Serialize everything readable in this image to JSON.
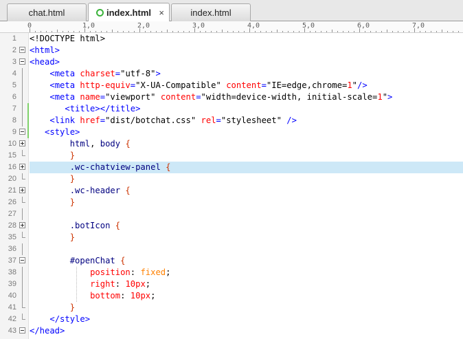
{
  "tabs": [
    {
      "label": "chat.html",
      "active": false,
      "has_close": false,
      "modified_indicator": false
    },
    {
      "label": "index.html",
      "active": true,
      "has_close": true,
      "modified_indicator": true
    },
    {
      "label": "index.html",
      "active": false,
      "has_close": false,
      "modified_indicator": false
    }
  ],
  "close_glyph": "×",
  "ruler": {
    "labels": [
      "0",
      "1,0",
      "2,0",
      "3,0",
      "4,0",
      "5,0",
      "6,0",
      "7,0"
    ]
  },
  "colors": {
    "tag": "#0000ff",
    "attribute": "#ff0000",
    "selector": "#000080",
    "brace": "#cc3300",
    "highlight": "#cde8f7",
    "change_bar": "#7fd26a"
  },
  "lines": [
    {
      "num": "1",
      "fold": null,
      "tokens": [
        [
          "plain",
          "<!DOCTYPE html>"
        ]
      ]
    },
    {
      "num": "2",
      "fold": "minus",
      "tokens": [
        [
          "tag",
          "<html>"
        ]
      ]
    },
    {
      "num": "3",
      "fold": "minus",
      "tokens": [
        [
          "tag",
          "<head>"
        ]
      ]
    },
    {
      "num": "4",
      "fold": null,
      "tokens": [
        [
          "plain",
          "    "
        ],
        [
          "tag",
          "<meta "
        ],
        [
          "attr",
          "charset"
        ],
        [
          "tag",
          "="
        ],
        [
          "val",
          "\"utf-8\""
        ],
        [
          "tag",
          ">"
        ]
      ]
    },
    {
      "num": "5",
      "fold": null,
      "tokens": [
        [
          "plain",
          "    "
        ],
        [
          "tag",
          "<meta "
        ],
        [
          "attr",
          "http-equiv"
        ],
        [
          "tag",
          "="
        ],
        [
          "val",
          "\"X-UA-Compatible\" "
        ],
        [
          "attr",
          "content"
        ],
        [
          "tag",
          "="
        ],
        [
          "val",
          "\"IE=edge,chrome="
        ],
        [
          "num",
          "1"
        ],
        [
          "val",
          "\""
        ],
        [
          "tag",
          "/>"
        ]
      ]
    },
    {
      "num": "6",
      "fold": null,
      "tokens": [
        [
          "plain",
          "    "
        ],
        [
          "tag",
          "<meta "
        ],
        [
          "attr",
          "name"
        ],
        [
          "tag",
          "="
        ],
        [
          "val",
          "\"viewport\" "
        ],
        [
          "attr",
          "content"
        ],
        [
          "tag",
          "="
        ],
        [
          "val",
          "\"width=device-width, initial-scale="
        ],
        [
          "num",
          "1"
        ],
        [
          "val",
          "\""
        ],
        [
          "tag",
          ">"
        ]
      ]
    },
    {
      "num": "7",
      "fold": null,
      "tokens": [
        [
          "plain",
          "       "
        ],
        [
          "tag",
          "<title></title>"
        ]
      ]
    },
    {
      "num": "8",
      "fold": null,
      "tokens": [
        [
          "plain",
          "    "
        ],
        [
          "tag",
          "<link "
        ],
        [
          "attr",
          "href"
        ],
        [
          "tag",
          "="
        ],
        [
          "val",
          "\"dist/botchat.css\" "
        ],
        [
          "attr",
          "rel"
        ],
        [
          "tag",
          "="
        ],
        [
          "val",
          "\"stylesheet\" "
        ],
        [
          "tag",
          "/>"
        ]
      ]
    },
    {
      "num": "9",
      "fold": "minus",
      "tokens": [
        [
          "plain",
          "   "
        ],
        [
          "tag",
          "<style>"
        ]
      ]
    },
    {
      "num": "10",
      "fold": "plus",
      "tokens": [
        [
          "plain",
          "        "
        ],
        [
          "sel",
          "html"
        ],
        [
          "plain",
          ", "
        ],
        [
          "sel",
          "body"
        ],
        [
          "plain",
          " "
        ],
        [
          "brace",
          "{"
        ]
      ]
    },
    {
      "num": "15",
      "fold": null,
      "tokens": [
        [
          "plain",
          "        "
        ],
        [
          "brace",
          "}"
        ]
      ]
    },
    {
      "num": "16",
      "fold": "plus",
      "highlight": true,
      "tokens": [
        [
          "plain",
          "        "
        ],
        [
          "sel",
          ".wc-chatview-panel"
        ],
        [
          "plain",
          " "
        ],
        [
          "brace",
          "{"
        ]
      ]
    },
    {
      "num": "20",
      "fold": null,
      "tokens": [
        [
          "plain",
          "        "
        ],
        [
          "brace",
          "}"
        ]
      ]
    },
    {
      "num": "21",
      "fold": "plus",
      "tokens": [
        [
          "plain",
          "        "
        ],
        [
          "sel",
          ".wc-header"
        ],
        [
          "plain",
          " "
        ],
        [
          "brace",
          "{"
        ]
      ]
    },
    {
      "num": "26",
      "fold": null,
      "tokens": [
        [
          "plain",
          "        "
        ],
        [
          "brace",
          "}"
        ]
      ]
    },
    {
      "num": "27",
      "fold": null,
      "tokens": []
    },
    {
      "num": "28",
      "fold": "plus",
      "tokens": [
        [
          "plain",
          "        "
        ],
        [
          "sel",
          ".botIcon"
        ],
        [
          "plain",
          " "
        ],
        [
          "brace",
          "{"
        ]
      ]
    },
    {
      "num": "35",
      "fold": null,
      "tokens": [
        [
          "plain",
          "        "
        ],
        [
          "brace",
          "}"
        ]
      ]
    },
    {
      "num": "36",
      "fold": null,
      "tokens": []
    },
    {
      "num": "37",
      "fold": "minus",
      "tokens": [
        [
          "plain",
          "        "
        ],
        [
          "sel",
          "#openChat"
        ],
        [
          "plain",
          " "
        ],
        [
          "brace",
          "{"
        ]
      ]
    },
    {
      "num": "38",
      "fold": null,
      "tokens": [
        [
          "plain",
          "            "
        ],
        [
          "prop",
          "position"
        ],
        [
          "plain",
          ": "
        ],
        [
          "kw",
          "fixed"
        ],
        [
          "plain",
          ";"
        ]
      ]
    },
    {
      "num": "39",
      "fold": null,
      "tokens": [
        [
          "plain",
          "            "
        ],
        [
          "prop",
          "right"
        ],
        [
          "plain",
          ": "
        ],
        [
          "num",
          "10px"
        ],
        [
          "plain",
          ";"
        ]
      ]
    },
    {
      "num": "40",
      "fold": null,
      "tokens": [
        [
          "plain",
          "            "
        ],
        [
          "prop",
          "bottom"
        ],
        [
          "plain",
          ": "
        ],
        [
          "num",
          "10px"
        ],
        [
          "plain",
          ";"
        ]
      ]
    },
    {
      "num": "41",
      "fold": null,
      "tokens": [
        [
          "plain",
          "        "
        ],
        [
          "brace",
          "}"
        ]
      ]
    },
    {
      "num": "42",
      "fold": null,
      "tokens": [
        [
          "plain",
          "    "
        ],
        [
          "tag",
          "</style>"
        ]
      ]
    },
    {
      "num": "43",
      "fold": "minus",
      "tokens": [
        [
          "tag",
          "</head>"
        ]
      ]
    }
  ]
}
